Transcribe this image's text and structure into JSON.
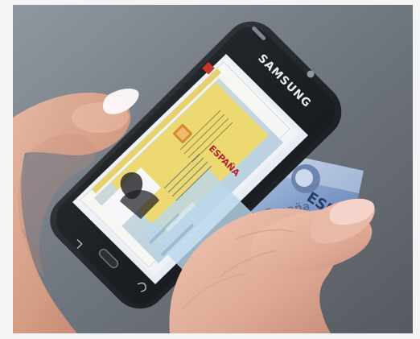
{
  "scene": {
    "phone_brand": "SAMSUNG",
    "country_text": "ESPAÑA",
    "card_country_text": "ESPAÑA",
    "card_side_text": "España"
  }
}
